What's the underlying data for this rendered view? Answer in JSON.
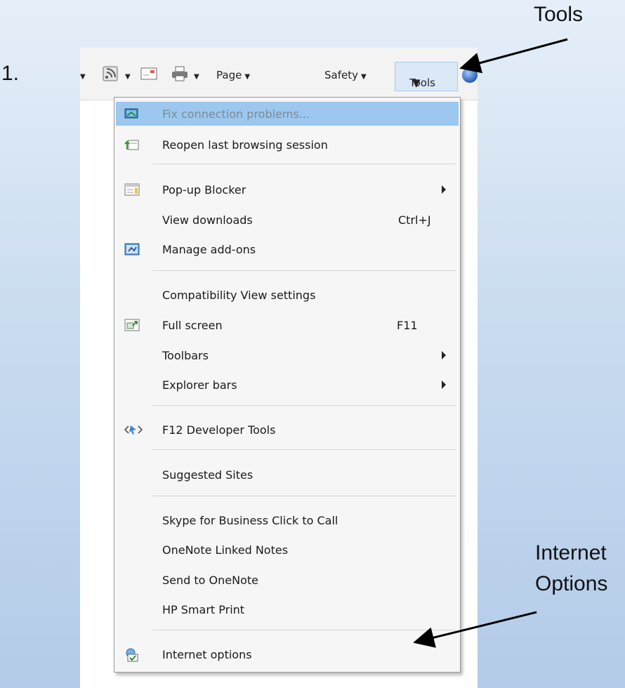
{
  "step_label": "1.",
  "callouts": {
    "tools": "Tools",
    "internet_line1": "Internet",
    "internet_line2": "Options"
  },
  "toolbar": {
    "page": "Page",
    "safety": "Safety",
    "tools": "Tools"
  },
  "menu": {
    "items": [
      {
        "label": "Fix connection problems...",
        "shortcut": "",
        "icon": "network-repair-icon"
      },
      {
        "label": "Reopen last browsing session",
        "shortcut": "",
        "icon": "reopen-session-icon"
      },
      {
        "label": "Pop-up Blocker",
        "shortcut": "",
        "icon": "popup-blocker-icon"
      },
      {
        "label": "View downloads",
        "shortcut": "Ctrl+J",
        "icon": ""
      },
      {
        "label": "Manage add-ons",
        "shortcut": "",
        "icon": "manage-addons-icon"
      },
      {
        "label": "Compatibility View settings",
        "shortcut": "",
        "icon": ""
      },
      {
        "label": "Full screen",
        "shortcut": "F11",
        "icon": "fullscreen-icon"
      },
      {
        "label": "Toolbars",
        "shortcut": "",
        "icon": ""
      },
      {
        "label": "Explorer bars",
        "shortcut": "",
        "icon": ""
      },
      {
        "label": "F12 Developer Tools",
        "shortcut": "",
        "icon": "developer-tools-icon"
      },
      {
        "label": "Suggested Sites",
        "shortcut": "",
        "icon": ""
      },
      {
        "label": "Skype for Business Click to Call",
        "shortcut": "",
        "icon": ""
      },
      {
        "label": "OneNote Linked Notes",
        "shortcut": "",
        "icon": ""
      },
      {
        "label": "Send to OneNote",
        "shortcut": "",
        "icon": ""
      },
      {
        "label": "HP Smart Print",
        "shortcut": "",
        "icon": ""
      },
      {
        "label": "Internet options",
        "shortcut": "",
        "icon": "internet-options-icon"
      }
    ]
  },
  "colors": {
    "highlight": "#9cc7ee",
    "arrow": "#000000"
  }
}
